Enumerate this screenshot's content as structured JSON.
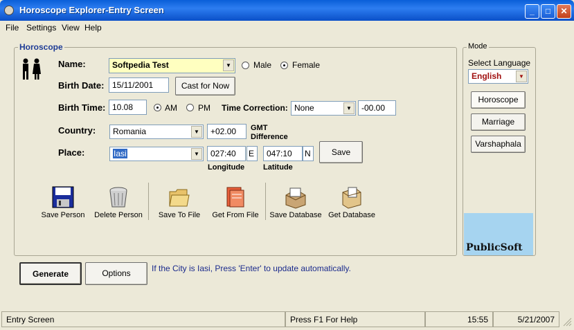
{
  "window": {
    "title": "Horoscope Explorer-Entry Screen"
  },
  "menu": [
    "File",
    "Settings",
    "View",
    "Help"
  ],
  "horoscope": {
    "group_title": "Horoscope",
    "name_label": "Name:",
    "name_value": "Softpedia Test",
    "gender_male": "Male",
    "gender_female": "Female",
    "birth_date_label": "Birth Date:",
    "birth_date_value": "15/11/2001",
    "cast_now_label": "Cast for Now",
    "birth_time_label": "Birth Time:",
    "birth_time_value": "10.08",
    "am_label": "AM",
    "pm_label": "PM",
    "time_correction_label": "Time Correction:",
    "time_correction_value": "None",
    "time_correction_amount": "-00.00",
    "country_label": "Country:",
    "country_value": "Romania",
    "gmt_value": "+02.00",
    "gmt_label_1": "GMT",
    "gmt_label_2": "Difference",
    "place_label": "Place:",
    "place_value": "Iasi",
    "longitude_value": "027:40",
    "longitude_dir": "E",
    "latitude_value": "047:10",
    "latitude_dir": "N",
    "longitude_label": "Longitude",
    "latitude_label": "Latitude",
    "save_label": "Save"
  },
  "toolbar": {
    "save_person": "Save Person",
    "delete_person": "Delete Person",
    "save_to_file": "Save To File",
    "get_from_file": "Get From File",
    "save_database": "Save Database",
    "get_database": "Get Database"
  },
  "mode": {
    "group_title": "Mode",
    "select_language_label": "Select Language",
    "language_value": "English",
    "horoscope_btn": "Horoscope",
    "marriage_btn": "Marriage",
    "varshaphala_btn": "Varshaphala",
    "logo_text": "PublicSoft"
  },
  "bottom": {
    "generate_label": "Generate",
    "options_label": "Options",
    "hint": "If the City is Iasi, Press 'Enter' to update automatically."
  },
  "statusbar": {
    "screen": "Entry Screen",
    "help": "Press F1 For Help",
    "time": "15:55",
    "date": "5/21/2007"
  }
}
